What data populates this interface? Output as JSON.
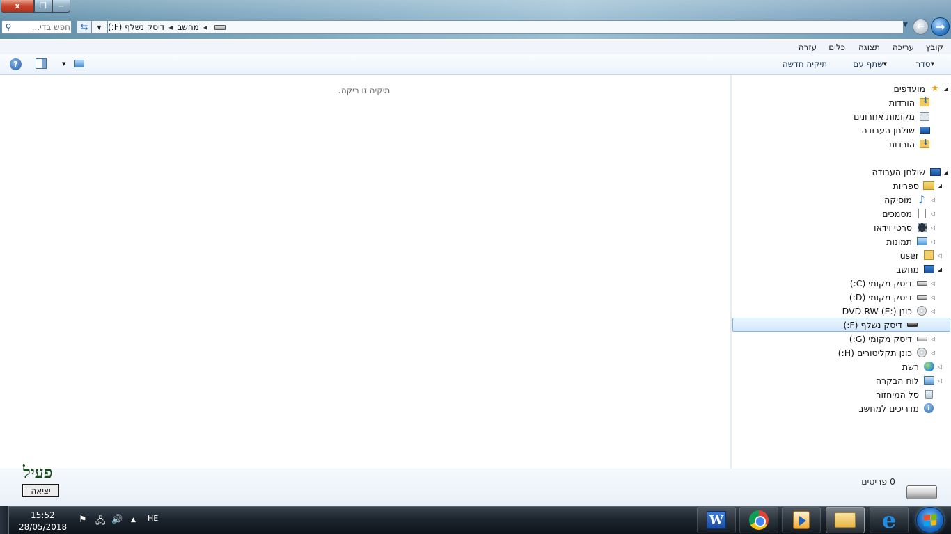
{
  "window": {
    "caption_buttons": {
      "close": "x",
      "restore": "❐",
      "minimize": "−"
    }
  },
  "address_bar": {
    "search_placeholder": "חפש בדי...",
    "breadcrumbs": [
      "מחשב",
      "דיסק נשלף (F:)"
    ]
  },
  "menu": {
    "items": [
      "קובץ",
      "עריכה",
      "תצוגה",
      "כלים",
      "עזרה"
    ]
  },
  "commands": {
    "organize": "סדר",
    "share_with": "שתף עם",
    "new_folder": "תיקיה חדשה"
  },
  "content": {
    "empty_message": "תיקיה זו ריקה."
  },
  "nav_tree": {
    "items": [
      {
        "label": "מועדפים",
        "icon": "star-icon",
        "arrow": "open"
      },
      {
        "label": "הורדות",
        "icon": "downloads-folder-icon",
        "arrow": ""
      },
      {
        "label": "מקומות אחרונים",
        "icon": "recent-places-icon",
        "arrow": ""
      },
      {
        "label": "שולחן העבודה",
        "icon": "desktop-icon",
        "arrow": ""
      },
      {
        "label": "הורדות",
        "icon": "downloads-folder-icon",
        "arrow": ""
      },
      {
        "label": "שולחן העבודה",
        "icon": "desktop-icon",
        "arrow": "open"
      },
      {
        "label": "ספריות",
        "icon": "libraries-icon",
        "arrow": "open"
      },
      {
        "label": "מוסיקה",
        "icon": "music-icon",
        "arrow": "closed"
      },
      {
        "label": "מסמכים",
        "icon": "documents-icon",
        "arrow": "closed"
      },
      {
        "label": "סרטי וידאו",
        "icon": "videos-icon",
        "arrow": "closed"
      },
      {
        "label": "תמונות",
        "icon": "pictures-icon",
        "arrow": "closed"
      },
      {
        "label": "user",
        "icon": "user-folder-icon",
        "arrow": "closed"
      },
      {
        "label": "מחשב",
        "icon": "computer-icon",
        "arrow": "open"
      },
      {
        "label": "דיסק מקומי (C:)",
        "icon": "drive-icon",
        "arrow": "closed"
      },
      {
        "label": "דיסק מקומי (D:)",
        "icon": "drive-icon",
        "arrow": "closed"
      },
      {
        "label": "כונן DVD RW (E:)",
        "icon": "optical-drive-icon",
        "arrow": "closed"
      },
      {
        "label": "דיסק נשלף (F:)",
        "icon": "removable-drive-icon",
        "arrow": "",
        "selected": true
      },
      {
        "label": "דיסק מקומי (G:)",
        "icon": "drive-icon",
        "arrow": "closed"
      },
      {
        "label": "כונן תקליטורים (H:)",
        "icon": "optical-drive-icon",
        "arrow": "closed"
      },
      {
        "label": "רשת",
        "icon": "network-icon",
        "arrow": "closed"
      },
      {
        "label": "לוח הבקרה",
        "icon": "control-panel-icon",
        "arrow": "closed"
      },
      {
        "label": "סל המיחזור",
        "icon": "recycle-bin-icon",
        "arrow": ""
      },
      {
        "label": "מדריכים למחשב",
        "icon": "info-icon",
        "arrow": ""
      }
    ]
  },
  "details": {
    "items_count": "0 פריטים"
  },
  "overlay": {
    "active_label": "פעיל",
    "exit_button": "יציאה"
  },
  "taskbar": {
    "time": "15:52",
    "date": "28/05/2018",
    "language": "HE",
    "pinned": [
      "word-icon",
      "chrome-icon",
      "media-player-icon",
      "explorer-icon",
      "internet-explorer-icon"
    ],
    "active_app": "explorer-icon"
  }
}
